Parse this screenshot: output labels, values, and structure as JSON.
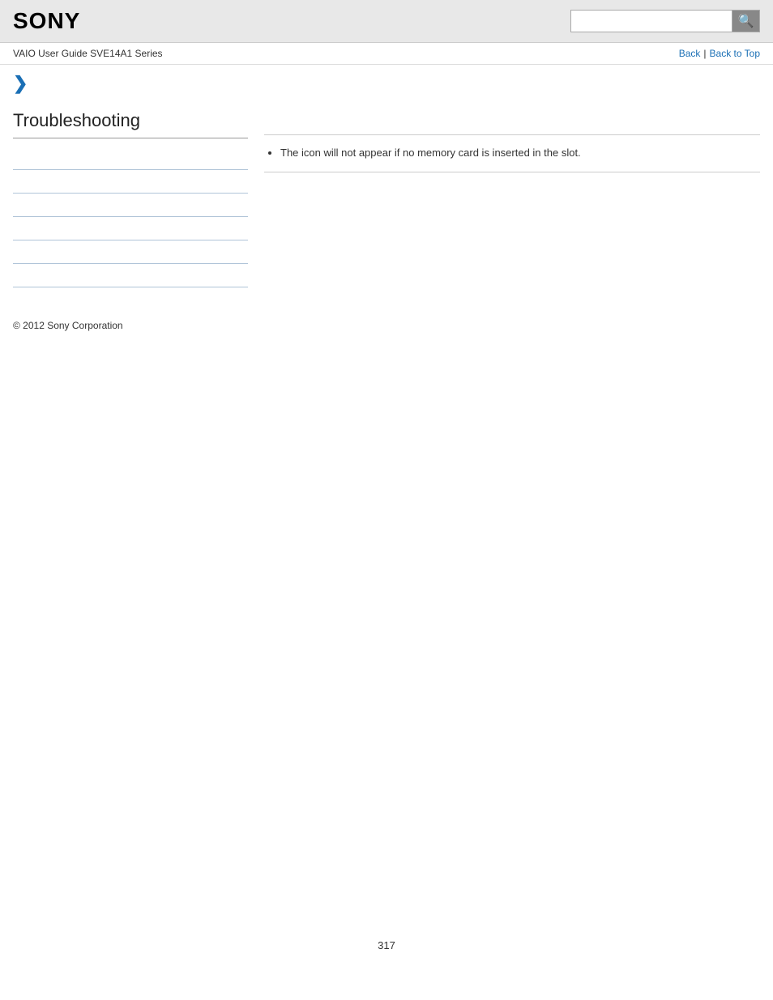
{
  "header": {
    "logo": "SONY",
    "search_placeholder": "",
    "search_icon": "🔍"
  },
  "nav": {
    "guide_title": "VAIO User Guide SVE14A1 Series",
    "back_label": "Back",
    "separator": "|",
    "back_to_top_label": "Back to Top"
  },
  "chevron": "❯",
  "sidebar": {
    "section_title": "Troubleshooting",
    "items": [
      {
        "label": "",
        "link": ""
      },
      {
        "label": "",
        "link": ""
      },
      {
        "label": "",
        "link": ""
      },
      {
        "label": "",
        "link": ""
      },
      {
        "label": "",
        "link": ""
      },
      {
        "label": "",
        "link": ""
      }
    ]
  },
  "content": {
    "divider_top": true,
    "bullets": [
      "The icon will not appear if no memory card is inserted in the slot."
    ]
  },
  "footer": {
    "copyright": "© 2012 Sony Corporation"
  },
  "page_number": "317"
}
